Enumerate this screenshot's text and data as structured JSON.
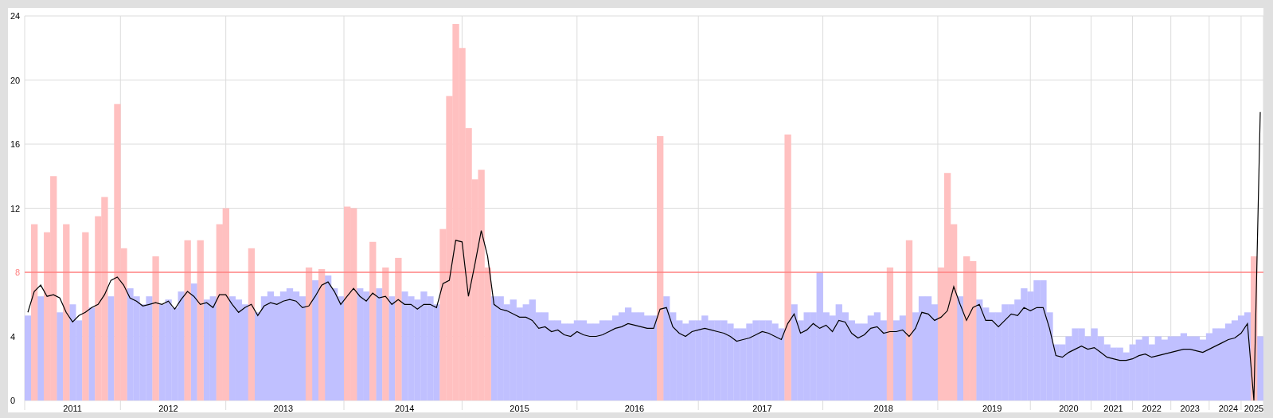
{
  "chart_data": {
    "type": "bar",
    "grid": true,
    "yticks": [
      0,
      4,
      12,
      16,
      20,
      24
    ],
    "ylim": [
      0,
      24
    ],
    "categories": [
      null,
      null,
      null,
      null,
      null,
      null,
      null,
      "2011",
      null,
      null,
      null,
      null,
      null,
      null,
      null,
      null,
      null,
      null,
      null,
      null,
      null,
      null,
      "2012",
      null,
      null,
      null,
      null,
      null,
      null,
      null,
      null,
      null,
      null,
      null,
      null,
      null,
      null,
      null,
      null,
      null,
      "2013",
      null,
      null,
      null,
      null,
      null,
      null,
      null,
      null,
      null,
      null,
      null,
      null,
      null,
      null,
      null,
      null,
      null,
      null,
      "2014",
      null,
      null,
      null,
      null,
      null,
      null,
      null,
      null,
      null,
      null,
      null,
      null,
      null,
      null,
      null,
      null,
      null,
      "2015",
      null,
      null,
      null,
      null,
      null,
      null,
      null,
      null,
      null,
      null,
      null,
      null,
      null,
      null,
      null,
      null,
      null,
      "2016",
      null,
      null,
      null,
      null,
      null,
      null,
      null,
      null,
      null,
      null,
      null,
      null,
      null,
      null,
      null,
      null,
      null,
      null,
      null,
      "2017",
      null,
      null,
      null,
      null,
      null,
      null,
      null,
      null,
      null,
      null,
      null,
      null,
      null,
      null,
      null,
      null,
      null,
      null,
      "2018",
      null,
      null,
      null,
      null,
      null,
      null,
      null,
      null,
      null,
      null,
      null,
      null,
      null,
      null,
      null,
      null,
      "2019",
      null,
      null,
      null,
      null,
      null,
      null,
      null,
      null,
      null,
      null,
      null,
      "2020",
      null,
      null,
      null,
      null,
      null,
      null,
      "2021",
      null,
      null,
      null,
      null,
      null,
      "2022",
      null,
      null,
      null,
      null,
      null,
      "2023",
      null,
      null,
      null,
      null,
      null,
      "2024",
      null,
      null,
      null,
      "2025",
      null
    ],
    "ref_lines": [
      {
        "axis": "y",
        "value": 8,
        "label": "8",
        "color": "#ff8080"
      }
    ],
    "series": [
      {
        "type": "bar",
        "color": "#c0c0ff",
        "values": [
          5.3,
          null,
          6.5,
          null,
          null,
          5.5,
          null,
          6.0,
          5.0,
          null,
          5.8,
          null,
          null,
          6.5,
          null,
          null,
          7.0,
          6.5,
          6.0,
          6.5,
          null,
          6.0,
          6.3,
          5.8,
          6.8,
          null,
          7.3,
          null,
          6.3,
          6.5,
          null,
          null,
          6.5,
          6.3,
          6.0,
          null,
          5.5,
          6.5,
          6.8,
          6.5,
          6.8,
          7.0,
          6.8,
          6.5,
          null,
          7.5,
          null,
          7.8,
          7.0,
          6.5,
          null,
          null,
          7.0,
          6.8,
          null,
          7.0,
          null,
          6.5,
          null,
          6.8,
          6.5,
          6.3,
          6.8,
          6.5,
          6.0,
          null,
          null,
          null,
          null,
          null,
          null,
          null,
          null,
          6.5,
          6.5,
          6.0,
          6.3,
          5.8,
          6.0,
          6.3,
          5.5,
          5.5,
          5.0,
          5.0,
          4.8,
          4.8,
          5.0,
          5.0,
          4.8,
          4.8,
          5.0,
          5.0,
          5.3,
          5.5,
          5.8,
          5.5,
          5.5,
          5.3,
          5.3,
          null,
          6.5,
          5.5,
          5.0,
          4.8,
          5.0,
          5.0,
          5.3,
          5.0,
          5.0,
          5.0,
          4.8,
          4.5,
          4.5,
          4.8,
          5.0,
          5.0,
          5.0,
          4.8,
          4.5,
          null,
          6.0,
          5.0,
          5.5,
          5.5,
          8.0,
          5.5,
          5.3,
          6.0,
          5.5,
          5.0,
          4.8,
          4.8,
          5.3,
          5.5,
          5.0,
          null,
          5.0,
          5.3,
          null,
          5.5,
          6.5,
          6.5,
          6.0,
          null,
          null,
          null,
          6.5,
          null,
          null,
          6.3,
          5.8,
          5.5,
          5.5,
          6.0,
          6.0,
          6.3,
          7.0,
          6.8,
          7.5,
          7.5,
          5.5,
          3.5,
          3.5,
          4.0,
          4.5,
          4.5,
          4.0,
          4.5,
          4.0,
          3.5,
          3.3,
          3.3,
          3.0,
          3.5,
          3.8,
          4.0,
          3.5,
          4.0,
          3.8,
          4.0,
          4.0,
          4.2,
          4.0,
          4.0,
          3.8,
          4.2,
          4.5,
          4.5,
          4.8,
          5.0,
          5.3,
          5.5,
          null,
          4.0
        ]
      },
      {
        "type": "bar",
        "color": "#ffc0c0",
        "values": [
          null,
          11.0,
          null,
          10.5,
          14.0,
          null,
          11.0,
          null,
          null,
          10.5,
          null,
          11.5,
          12.7,
          null,
          18.5,
          9.5,
          null,
          null,
          null,
          null,
          9.0,
          null,
          null,
          null,
          null,
          10.0,
          null,
          10.0,
          null,
          null,
          11.0,
          12.0,
          null,
          null,
          null,
          9.5,
          null,
          null,
          null,
          null,
          null,
          null,
          null,
          null,
          8.3,
          null,
          8.2,
          null,
          null,
          null,
          12.1,
          12.0,
          null,
          null,
          9.9,
          null,
          8.3,
          null,
          8.9,
          null,
          null,
          null,
          null,
          null,
          null,
          10.7,
          19.0,
          23.5,
          22.0,
          17.0,
          13.8,
          14.4,
          8.3,
          null,
          null,
          null,
          null,
          null,
          null,
          null,
          null,
          null,
          null,
          null,
          null,
          null,
          null,
          null,
          null,
          null,
          null,
          null,
          null,
          null,
          null,
          null,
          null,
          null,
          null,
          16.5,
          null,
          null,
          null,
          null,
          null,
          null,
          null,
          null,
          null,
          null,
          null,
          null,
          null,
          null,
          null,
          null,
          null,
          null,
          null,
          16.6,
          null,
          null,
          null,
          null,
          null,
          null,
          null,
          null,
          null,
          null,
          null,
          null,
          null,
          null,
          null,
          8.3,
          null,
          null,
          10.0,
          null,
          null,
          null,
          null,
          8.3,
          14.2,
          11.0,
          null,
          9.0,
          8.7,
          null,
          null,
          null,
          null,
          null,
          null,
          null,
          null,
          null,
          null,
          null,
          null,
          null,
          null,
          null,
          null,
          null,
          null,
          null,
          null,
          null,
          null,
          null,
          null,
          null,
          null,
          null,
          null,
          null,
          null,
          null,
          null,
          null,
          null,
          null,
          null,
          null,
          null,
          null,
          null,
          null,
          null,
          null,
          9.0,
          null
        ]
      },
      {
        "type": "line",
        "color": "#000000",
        "values": [
          5.5,
          6.8,
          7.2,
          6.5,
          6.6,
          6.4,
          5.5,
          4.9,
          5.3,
          5.5,
          5.8,
          6.0,
          6.6,
          7.5,
          7.7,
          7.2,
          6.4,
          6.2,
          5.9,
          6.0,
          6.1,
          6.0,
          6.2,
          5.7,
          6.3,
          6.8,
          6.5,
          6.0,
          6.1,
          5.8,
          6.6,
          6.6,
          6.0,
          5.5,
          5.8,
          6.0,
          5.3,
          5.9,
          6.1,
          6.0,
          6.2,
          6.3,
          6.2,
          5.8,
          5.9,
          6.5,
          7.2,
          7.4,
          6.8,
          6.0,
          6.5,
          7.0,
          6.5,
          6.2,
          6.7,
          6.4,
          6.5,
          6.0,
          6.3,
          6.0,
          6.0,
          5.7,
          6.0,
          6.0,
          5.8,
          7.3,
          7.5,
          10.0,
          9.9,
          6.5,
          8.5,
          10.6,
          9.0,
          6.0,
          5.7,
          5.6,
          5.4,
          5.2,
          5.2,
          5.0,
          4.5,
          4.6,
          4.3,
          4.4,
          4.1,
          4.0,
          4.3,
          4.1,
          4.0,
          4.0,
          4.1,
          4.3,
          4.5,
          4.6,
          4.8,
          4.7,
          4.6,
          4.5,
          4.5,
          5.7,
          5.8,
          4.6,
          4.2,
          4.0,
          4.3,
          4.4,
          4.5,
          4.4,
          4.3,
          4.2,
          4.0,
          3.7,
          3.8,
          3.9,
          4.1,
          4.3,
          4.2,
          4.0,
          3.8,
          4.8,
          5.4,
          4.2,
          4.4,
          4.8,
          4.5,
          4.7,
          4.3,
          5.0,
          4.9,
          4.2,
          3.9,
          4.1,
          4.5,
          4.6,
          4.2,
          4.3,
          4.3,
          4.4,
          4.0,
          4.5,
          5.5,
          5.4,
          5.0,
          5.2,
          5.6,
          7.1,
          6.0,
          5.0,
          5.8,
          6.0,
          5.0,
          5.0,
          4.6,
          5.0,
          5.4,
          5.3,
          5.8,
          5.6,
          5.8,
          5.8,
          4.5,
          2.8,
          2.7,
          3.0,
          3.2,
          3.4,
          3.2,
          3.3,
          3.0,
          2.7,
          2.6,
          2.5,
          2.5,
          2.6,
          2.8,
          2.9,
          2.7,
          2.8,
          2.9,
          3.0,
          3.1,
          3.2,
          3.2,
          3.1,
          3.0,
          3.2,
          3.4,
          3.6,
          3.8,
          3.9,
          4.2,
          4.8,
          0,
          18.0
        ]
      }
    ]
  }
}
